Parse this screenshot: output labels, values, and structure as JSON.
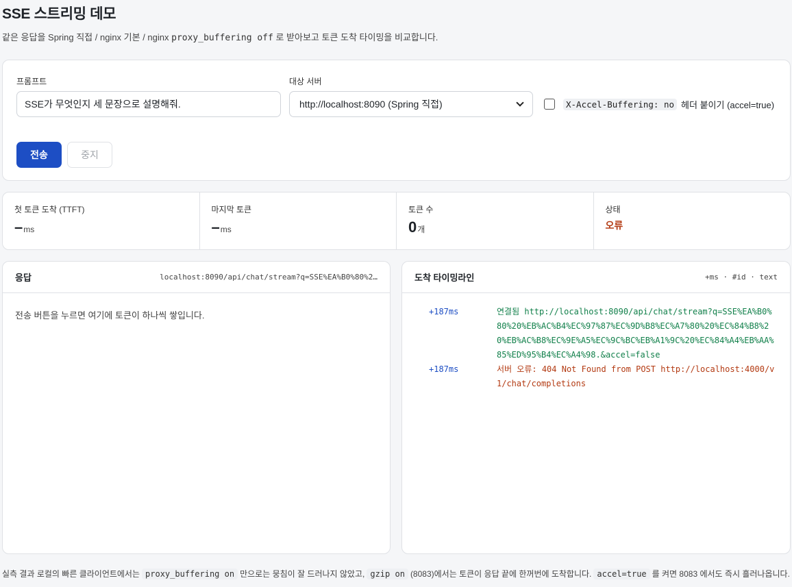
{
  "header": {
    "title": "SSE 스트리밍 데모",
    "subtitle_before": "같은 응답을 Spring 직접 / nginx 기본 / nginx",
    "subtitle_code": "proxy_buffering off",
    "subtitle_after": "로 받아보고 토큰 도착 타이밍을 비교합니다."
  },
  "form": {
    "prompt_label": "프롬프트",
    "prompt_value": "SSE가 무엇인지 세 문장으로 설명해줘.",
    "server_label": "대상 서버",
    "server_selected": "http://localhost:8090 (Spring 직접)",
    "accel_checked": false,
    "accel_code": "X-Accel-Buffering: no",
    "accel_text": "헤더 붙이기 (accel=true)",
    "send_label": "전송",
    "stop_label": "중지"
  },
  "stats": {
    "ttft_label": "첫 토큰 도착 (TTFT)",
    "ttft_value": "–",
    "ttft_unit": "ms",
    "last_label": "마지막 토큰",
    "last_value": "–",
    "last_unit": "ms",
    "count_label": "토큰 수",
    "count_value": "0",
    "count_unit": "개",
    "status_label": "상태",
    "status_value": "오류"
  },
  "response_panel": {
    "title": "응답",
    "url": "localhost:8090/api/chat/stream?q=SSE%EA%B0%80%2…",
    "placeholder": "전송 버튼을 누르면 여기에 토큰이 하나씩 쌓입니다."
  },
  "timeline_panel": {
    "title": "도착 타이밍라인",
    "legend": "+ms · #id · text",
    "entries": [
      {
        "ms": "+187ms",
        "text": "연결됨 http://localhost:8090/api/chat/stream?q=SSE%EA%B0%80%20%EB%AC%B4%EC%97%87%EC%9D%B8%EC%A7%80%20%EC%84%B8%20%EB%AC%B8%EC%9E%A5%EC%9C%BC%EB%A1%9C%20%EC%84%A4%EB%AA%85%ED%95%B4%EC%A4%98.&accel=false"
      },
      {
        "ms": "+187ms",
        "text": "서버 오류: 404 Not Found from POST http://localhost:4000/v1/chat/completions"
      }
    ]
  },
  "footer": {
    "t1": "실측 결과 로컬의 빠른 클라이언트에서는",
    "c1": "proxy_buffering on",
    "t2": "만으로는 뭉침이 잘 드러나지 않았고,",
    "c2": "gzip on",
    "t3": "(8083)에서는 토큰이 응답 끝에 한꺼번에 도착합니다.",
    "c3": "accel=true",
    "t4": "를 켜면 8083 에서도 즉시 흘러나옵니다."
  },
  "colors": {
    "accent": "#1d4ec4",
    "error": "#b33a12",
    "success": "#12804b"
  }
}
